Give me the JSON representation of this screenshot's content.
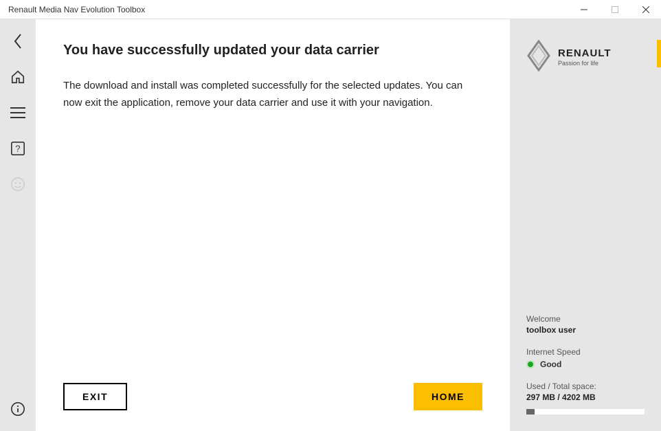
{
  "window": {
    "title": "Renault Media Nav Evolution Toolbox"
  },
  "main": {
    "heading": "You have successfully updated your data carrier",
    "body": "The download and install was completed successfully for the selected updates. You can now exit the application, remove your data carrier and use it with your navigation.",
    "exit_label": "EXIT",
    "home_label": "HOME"
  },
  "brand": {
    "name": "RENAULT",
    "tagline": "Passion for life"
  },
  "status": {
    "welcome_label": "Welcome",
    "username": "toolbox user",
    "internet_label": "Internet Speed",
    "internet_value": "Good",
    "space_label": "Used / Total space:",
    "space_value": "297 MB / 4202 MB",
    "space_percent": 7
  }
}
